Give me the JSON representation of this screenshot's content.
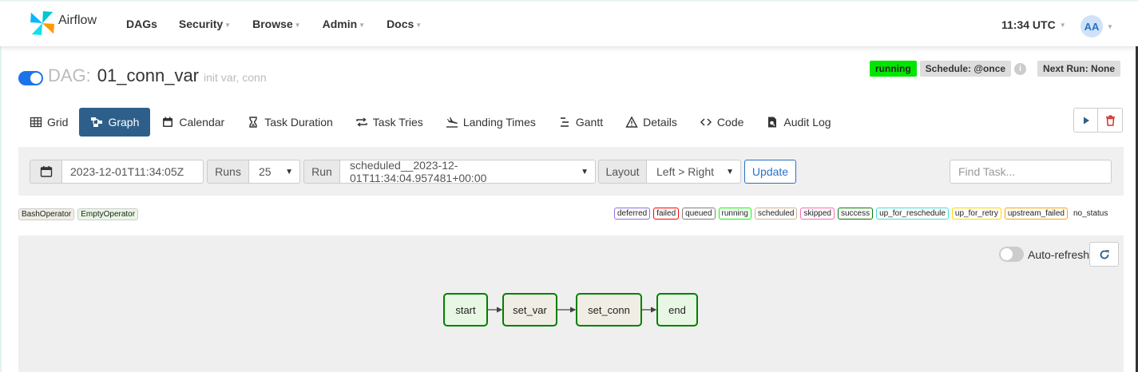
{
  "brand": {
    "name": "Airflow"
  },
  "nav": {
    "items": [
      {
        "label": "DAGs",
        "dropdown": false
      },
      {
        "label": "Security",
        "dropdown": true
      },
      {
        "label": "Browse",
        "dropdown": true
      },
      {
        "label": "Admin",
        "dropdown": true
      },
      {
        "label": "Docs",
        "dropdown": true
      }
    ],
    "clock": "11:34 UTC",
    "user_initials": "AA"
  },
  "dag": {
    "prefix": "DAG:",
    "name": "01_conn_var",
    "tags": "init var, conn",
    "status": "running",
    "schedule": "Schedule: @once",
    "info_icon": "i",
    "next_run": "Next Run: None"
  },
  "tabs": [
    {
      "label": "Grid",
      "icon": "grid-icon",
      "active": false
    },
    {
      "label": "Graph",
      "icon": "graph-icon",
      "active": true
    },
    {
      "label": "Calendar",
      "icon": "calendar-icon",
      "active": false
    },
    {
      "label": "Task Duration",
      "icon": "hourglass-icon",
      "active": false
    },
    {
      "label": "Task Tries",
      "icon": "repeat-icon",
      "active": false
    },
    {
      "label": "Landing Times",
      "icon": "landing-icon",
      "active": false
    },
    {
      "label": "Gantt",
      "icon": "gantt-icon",
      "active": false
    },
    {
      "label": "Details",
      "icon": "warning-triangle-icon",
      "active": false
    },
    {
      "label": "Code",
      "icon": "code-icon",
      "active": false
    },
    {
      "label": "Audit Log",
      "icon": "audit-log-icon",
      "active": false
    }
  ],
  "filters": {
    "date": "2023-12-01T11:34:05Z",
    "runs_label": "Runs",
    "runs_value": "25",
    "run_label": "Run",
    "run_value": "scheduled__2023-12-01T11:34:04.957481+00:00",
    "layout_label": "Layout",
    "layout_value": "Left > Right",
    "update_label": "Update",
    "find_task_placeholder": "Find Task..."
  },
  "operators": [
    {
      "label": "BashOperator",
      "color": "#f0ede4"
    },
    {
      "label": "EmptyOperator",
      "color": "#e8f7e4"
    }
  ],
  "states": [
    {
      "label": "deferred",
      "color": "#9370db"
    },
    {
      "label": "failed",
      "color": "#ff0000"
    },
    {
      "label": "queued",
      "color": "#808080"
    },
    {
      "label": "running",
      "color": "#00ff00"
    },
    {
      "label": "scheduled",
      "color": "#d2b48c"
    },
    {
      "label": "skipped",
      "color": "#ff69b4"
    },
    {
      "label": "success",
      "color": "#008000"
    },
    {
      "label": "up_for_reschedule",
      "color": "#40e0d0"
    },
    {
      "label": "up_for_retry",
      "color": "#ffd700"
    },
    {
      "label": "upstream_failed",
      "color": "#ffa500"
    }
  ],
  "no_status_label": "no_status",
  "graph": {
    "autorefresh_label": "Auto-refresh",
    "nodes": [
      {
        "label": "start",
        "operator": "EmptyOperator",
        "state": "success"
      },
      {
        "label": "set_var",
        "operator": "BashOperator",
        "state": "success"
      },
      {
        "label": "set_conn",
        "operator": "BashOperator",
        "state": "success"
      },
      {
        "label": "end",
        "operator": "EmptyOperator",
        "state": "success"
      }
    ]
  },
  "colors": {
    "active_tab": "#2d5f8a",
    "success_border": "#008000",
    "running_badge": "#00e600",
    "toggle_on": "#1a73e8"
  }
}
